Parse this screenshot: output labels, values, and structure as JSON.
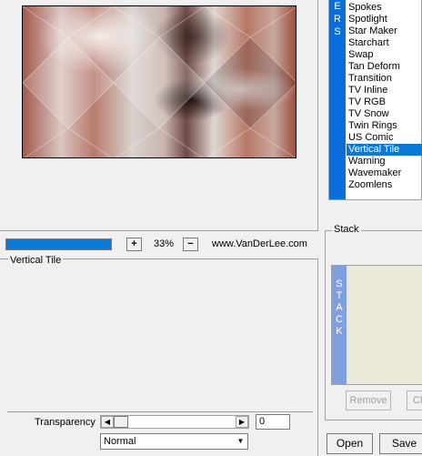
{
  "preview": {
    "zoom_in_label": "+",
    "zoom_out_label": "−",
    "zoom_value": "33%",
    "zoom_progress": 1.0,
    "website": "www.VanDerLee.com"
  },
  "settings": {
    "title": "Vertical Tile",
    "transparency_label": "Transparency",
    "transparency_value": "0",
    "blend_mode": "Normal"
  },
  "filters": {
    "tab_label": [
      "E",
      "R",
      "S"
    ],
    "items": [
      {
        "label": "Spokes"
      },
      {
        "label": "Spotlight"
      },
      {
        "label": "Star Maker"
      },
      {
        "label": "Starchart"
      },
      {
        "label": "Swap"
      },
      {
        "label": "Tan Deform"
      },
      {
        "label": "Transition"
      },
      {
        "label": "TV Inline"
      },
      {
        "label": "TV RGB"
      },
      {
        "label": "TV Snow"
      },
      {
        "label": "Twin Rings"
      },
      {
        "label": "US Comic"
      },
      {
        "label": "Vertical Tile",
        "selected": true
      },
      {
        "label": "Warning"
      },
      {
        "label": "Wavemaker"
      },
      {
        "label": "Zoomlens"
      }
    ]
  },
  "stack": {
    "title": "Stack",
    "tab_letters": [
      "S",
      "T",
      "A",
      "C",
      "K"
    ],
    "remove_label": "Remove",
    "clear_label": "Cl"
  },
  "buttons": {
    "open_label": "Open",
    "save_label": "Save"
  },
  "icons": {
    "left_arrow": "◀",
    "right_arrow": "▶",
    "dropdown_arrow": "▼"
  },
  "colors": {
    "accent": "#0a78d7",
    "filters_tab": "#0b6ed8",
    "stack_tab": "#7f9fde",
    "stack_bg": "#ece9d8"
  }
}
